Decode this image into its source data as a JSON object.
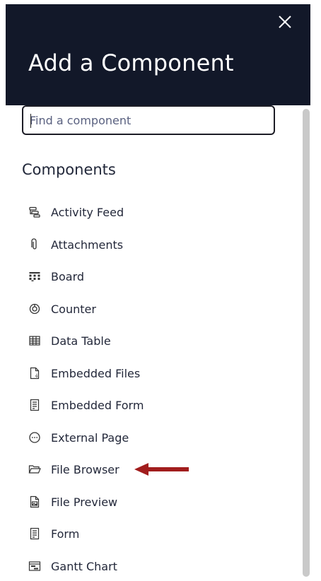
{
  "header": {
    "title": "Add a Component"
  },
  "search": {
    "placeholder": "Find a component"
  },
  "section": {
    "heading": "Components"
  },
  "components": [
    {
      "label": "Activity Feed",
      "icon": "activity-feed-icon"
    },
    {
      "label": "Attachments",
      "icon": "paperclip-icon"
    },
    {
      "label": "Board",
      "icon": "board-icon"
    },
    {
      "label": "Counter",
      "icon": "counter-icon"
    },
    {
      "label": "Data Table",
      "icon": "table-icon"
    },
    {
      "label": "Embedded Files",
      "icon": "file-icon"
    },
    {
      "label": "Embedded Form",
      "icon": "form-icon"
    },
    {
      "label": "External Page",
      "icon": "external-page-icon"
    },
    {
      "label": "File Browser",
      "icon": "folder-open-icon"
    },
    {
      "label": "File Preview",
      "icon": "file-preview-icon"
    },
    {
      "label": "Form",
      "icon": "form-icon"
    },
    {
      "label": "Gantt Chart",
      "icon": "gantt-chart-icon"
    }
  ],
  "colors": {
    "header_bg": "#121829",
    "arrow": "#a11d1d",
    "scrollbar": "#c9c9c9"
  }
}
